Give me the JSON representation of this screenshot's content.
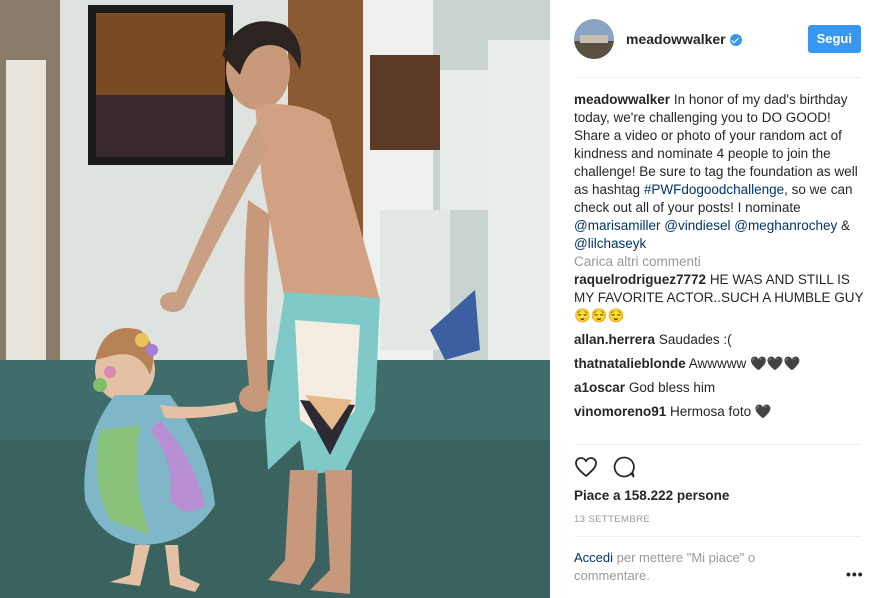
{
  "post": {
    "username": "meadowwalker",
    "follow_label": "Segui",
    "caption": {
      "username": "meadowwalker",
      "text_1": "In honor of my dad's birthday today, we're challenging you to DO GOOD! Share a video or photo of your random act of kindness and nominate 4 people to join the challenge! Be sure to tag the foundation as well as hashtag ",
      "hashtag": "#PWFdogoodchallenge",
      "text_2": ", so we can check out all of your posts! I nominate ",
      "mention_1": "@marisamiller",
      "mention_2": "@vindiesel",
      "mention_3": "@meghanrochey",
      "and": " & ",
      "mention_4": "@lilchaseyk"
    },
    "load_more": "Carica altri commenti",
    "comments": [
      {
        "user": "raquelrodriguez7772",
        "text": "HE WAS AND STILL IS MY FAVORITE ACTOR..SUCH A HUMBLE GUY 😌😌😌"
      },
      {
        "user": "allan.herrera",
        "text": "Saudades :("
      },
      {
        "user": "thatnatalieblonde",
        "text": "Awwwww 🖤🖤🖤"
      },
      {
        "user": "a1oscar",
        "text": "God bless him"
      },
      {
        "user": "vinomoreno91",
        "text": "Hermosa foto 🖤"
      }
    ],
    "likes": "Piace a 158.222 persone",
    "date": "13 SETTEMBRE",
    "footer": {
      "login": "Accedi",
      "rest": " per mettere \"Mi piace\" o commentare."
    },
    "more_options": "•••"
  },
  "icons": {
    "like": "heart-icon",
    "comment": "comment-icon",
    "verified": "verified-badge-icon",
    "more": "more-options-icon"
  },
  "colors": {
    "accent": "#3897f0",
    "link": "#003569",
    "muted": "#999999"
  }
}
